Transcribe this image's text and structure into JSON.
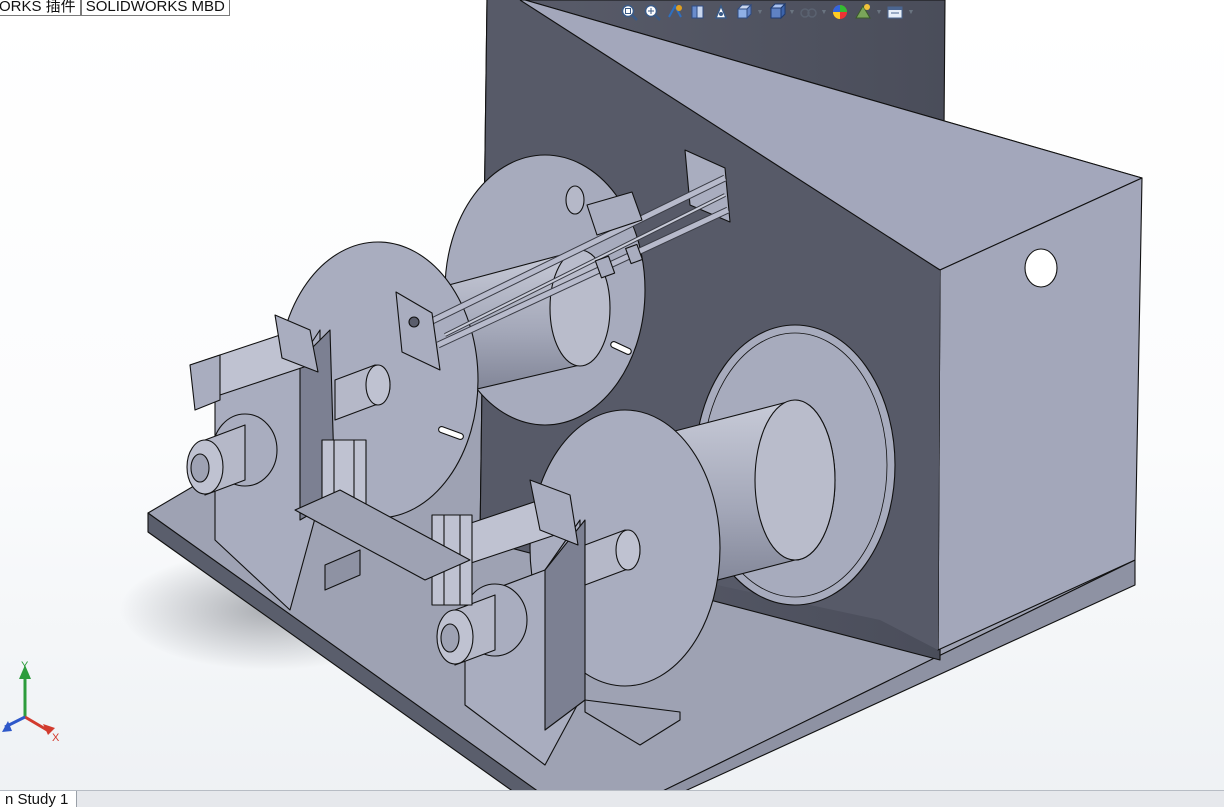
{
  "command_tabs": [
    "ORKS 插件",
    "SOLIDWORKS MBD"
  ],
  "heads_up_toolbar": {
    "buttons": [
      {
        "icon": "zoom-to-fit-icon",
        "dropdown": false
      },
      {
        "icon": "zoom-to-area-icon",
        "dropdown": false
      },
      {
        "icon": "previous-view-icon",
        "dropdown": false
      },
      {
        "icon": "section-view-icon",
        "dropdown": false
      },
      {
        "icon": "dynamic-annotation-views-icon",
        "dropdown": false
      },
      {
        "icon": "view-orientation-icon",
        "dropdown": true
      },
      {
        "icon": "display-style-icon",
        "dropdown": true
      },
      {
        "icon": "hide-show-items-icon",
        "dropdown": true
      },
      {
        "icon": "edit-appearance-icon",
        "dropdown": false
      },
      {
        "icon": "apply-scene-icon",
        "dropdown": true
      },
      {
        "icon": "view-settings-icon",
        "dropdown": true
      }
    ]
  },
  "triad": {
    "x_label": "X",
    "y_label": "Y"
  },
  "bottom_tab": {
    "label": "n Study 1"
  },
  "colors": {
    "part_face": "#a9adbd",
    "part_face_dark": "#575a68",
    "part_face_darker": "#4b4e5c",
    "part_face_light": "#c3c6d3",
    "edge": "#111111",
    "axis_x": "#d23b2e",
    "axis_y": "#2d9c3c",
    "axis_z": "#2e58c9"
  }
}
